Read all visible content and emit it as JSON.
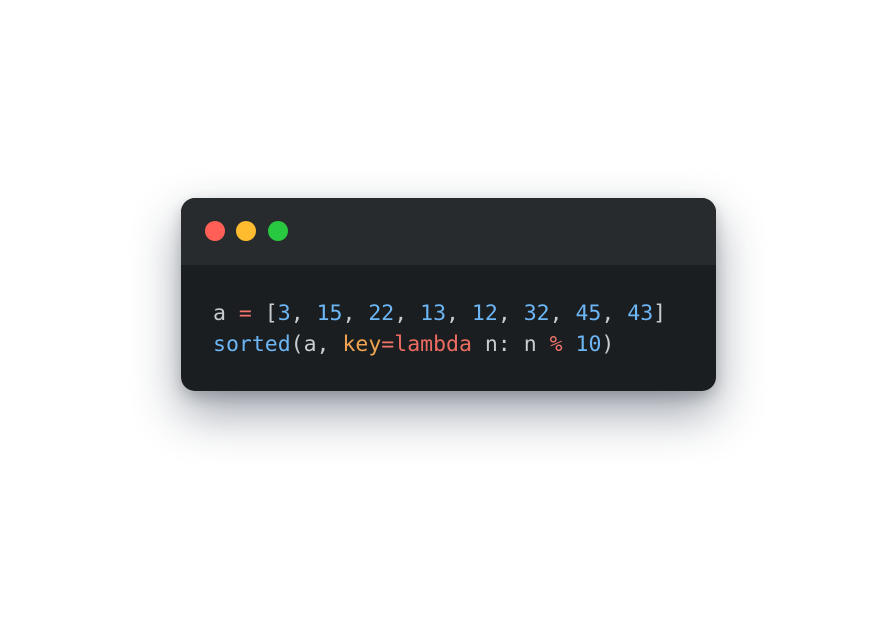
{
  "window": {
    "controls": {
      "close_color": "#ff5f57",
      "minimize_color": "#febc2e",
      "zoom_color": "#28c840"
    }
  },
  "code": {
    "lines": [
      {
        "tokens": [
          {
            "text": "a ",
            "kind": "plain"
          },
          {
            "text": "=",
            "kind": "op"
          },
          {
            "text": " [",
            "kind": "plain"
          },
          {
            "text": "3",
            "kind": "num"
          },
          {
            "text": ", ",
            "kind": "plain"
          },
          {
            "text": "15",
            "kind": "num"
          },
          {
            "text": ", ",
            "kind": "plain"
          },
          {
            "text": "22",
            "kind": "num"
          },
          {
            "text": ", ",
            "kind": "plain"
          },
          {
            "text": "13",
            "kind": "num"
          },
          {
            "text": ", ",
            "kind": "plain"
          },
          {
            "text": "12",
            "kind": "num"
          },
          {
            "text": ", ",
            "kind": "plain"
          },
          {
            "text": "32",
            "kind": "num"
          },
          {
            "text": ", ",
            "kind": "plain"
          },
          {
            "text": "45",
            "kind": "num"
          },
          {
            "text": ", ",
            "kind": "plain"
          },
          {
            "text": "43",
            "kind": "num"
          },
          {
            "text": "]",
            "kind": "plain"
          }
        ]
      },
      {
        "tokens": [
          {
            "text": "sorted",
            "kind": "func"
          },
          {
            "text": "(a, ",
            "kind": "plain"
          },
          {
            "text": "key",
            "kind": "key"
          },
          {
            "text": "=",
            "kind": "op"
          },
          {
            "text": "lambda",
            "kind": "kw"
          },
          {
            "text": " n: n ",
            "kind": "plain"
          },
          {
            "text": "%",
            "kind": "op"
          },
          {
            "text": " ",
            "kind": "plain"
          },
          {
            "text": "10",
            "kind": "num"
          },
          {
            "text": ")",
            "kind": "plain"
          }
        ]
      }
    ]
  },
  "colors": {
    "background": "#ffffff",
    "window_body": "#1b1e20",
    "titlebar": "#282b2d",
    "plain": "#c9ccce",
    "operator": "#f0746b",
    "number": "#6cb6f5",
    "function": "#6cb6f5",
    "keyword_arg": "#f0a44f",
    "keyword": "#ec6c62"
  }
}
